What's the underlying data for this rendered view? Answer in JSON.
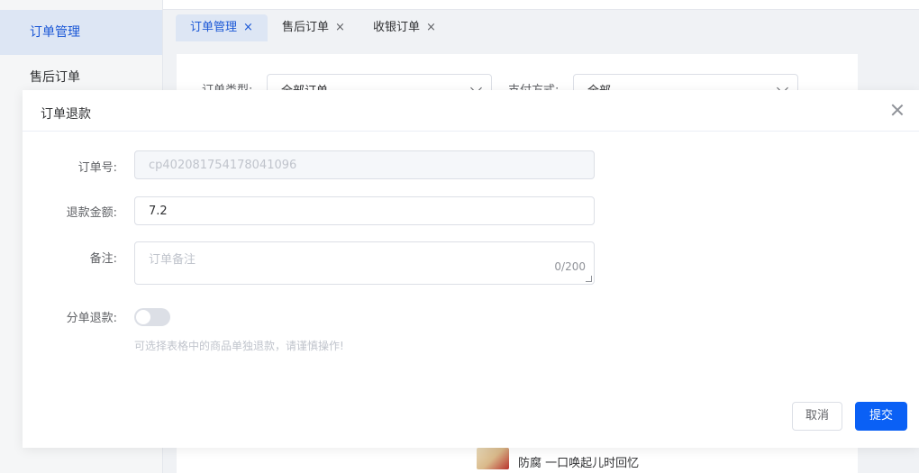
{
  "sidebar": {
    "items": [
      {
        "label": "订单管理"
      },
      {
        "label": "售后订单"
      }
    ]
  },
  "tabs": [
    {
      "label": "订单管理",
      "close": "×"
    },
    {
      "label": "售后订单",
      "close": "×"
    },
    {
      "label": "收银订单",
      "close": "×"
    }
  ],
  "filters": {
    "order_type_label": "订单类型:",
    "order_type_value": "全部订单",
    "payment_label": "支付方式:",
    "payment_value": "全部"
  },
  "product_row": {
    "name": "防腐 一口唤起儿时回忆"
  },
  "modal": {
    "title": "订单退款",
    "fields": {
      "order_no_label": "订单号:",
      "order_no_value": "cp402081754178041096",
      "amount_label": "退款金额:",
      "amount_value": "7.2",
      "remark_label": "备注:",
      "remark_placeholder": "订单备注",
      "remark_count": "0/200",
      "split_label": "分单退款:",
      "split_enabled": false,
      "split_hint": "可选择表格中的商品单独退款，请谨慎操作!"
    },
    "cancel_label": "取消",
    "submit_label": "提交"
  },
  "colors": {
    "primary": "#0a60f5",
    "active_tab_bg": "#dde6f4",
    "active_text": "#1a57d6"
  }
}
